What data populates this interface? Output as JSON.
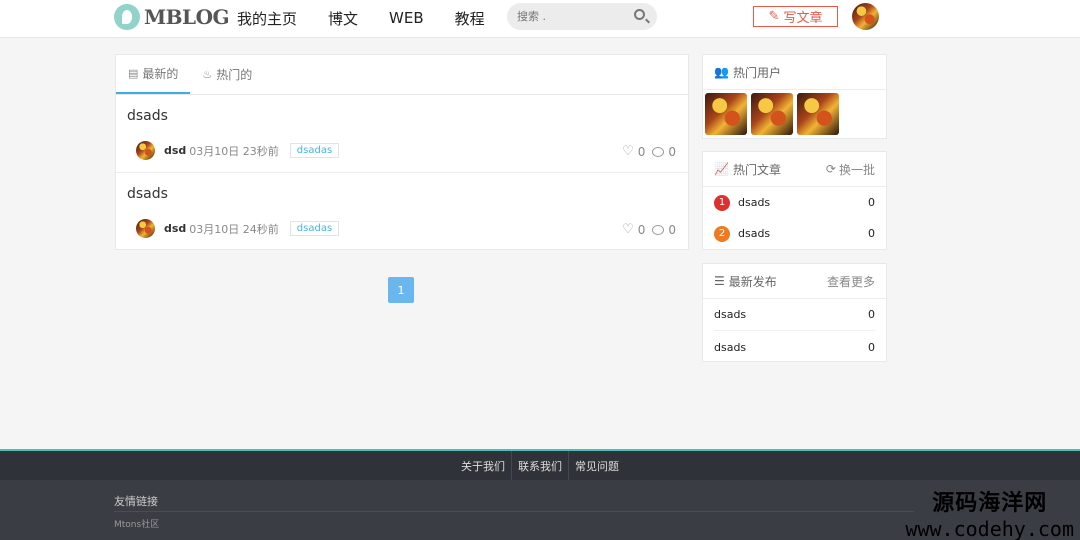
{
  "header": {
    "logo_text": "MBLOG",
    "nav": [
      "我的主页",
      "博文",
      "WEB",
      "教程"
    ],
    "search_placeholder": "搜索 .",
    "write_label": "写文章"
  },
  "tabs": [
    {
      "label": "最新的",
      "icon": "newspaper-icon"
    },
    {
      "label": "热门的",
      "icon": "fire-icon"
    }
  ],
  "posts": [
    {
      "title": "dsads",
      "author": "dsd",
      "time": "03月10日 23秒前",
      "tag": "dsadas",
      "likes": "0",
      "comments": "0"
    },
    {
      "title": "dsads",
      "author": "dsd",
      "time": "03月10日 24秒前",
      "tag": "dsadas",
      "likes": "0",
      "comments": "0"
    }
  ],
  "pagination": {
    "current": "1"
  },
  "sidebar": {
    "hot_users": {
      "title": "热门用户"
    },
    "hot_posts": {
      "title": "热门文章",
      "action": "换一批",
      "items": [
        {
          "rank": "1",
          "title": "dsads",
          "count": "0"
        },
        {
          "rank": "2",
          "title": "dsads",
          "count": "0"
        }
      ]
    },
    "latest": {
      "title": "最新发布",
      "action": "查看更多",
      "items": [
        {
          "title": "dsads",
          "count": "0"
        },
        {
          "title": "dsads",
          "count": "0"
        }
      ]
    }
  },
  "footer": {
    "links": [
      "关于我们",
      "联系我们",
      "常见问题"
    ],
    "friends_title": "友情链接",
    "friends": [
      "Mtons社区"
    ]
  },
  "watermark": {
    "line1": "源码海洋网",
    "line2": "www.codehy.com"
  }
}
